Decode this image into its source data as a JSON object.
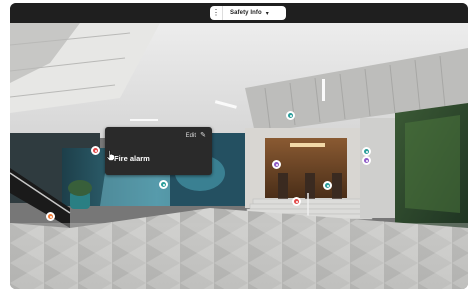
{
  "toolbar": {
    "menu_icon": "vertical-dots-icon",
    "dropdown_label": "Safety Info",
    "dropdown_icon": "chevron-down-icon"
  },
  "tooltip": {
    "edit_label": "Edit",
    "edit_icon": "pencil-icon",
    "tag_title": "Fire alarm"
  },
  "hotspots": [
    {
      "name": "hotspot-fire-alarm",
      "color": "#e24a4a"
    },
    {
      "name": "hotspot-ceiling",
      "color": "#2a9d9a"
    },
    {
      "name": "hotspot-left-wall",
      "color": "#2a9d9a"
    },
    {
      "name": "hotspot-escalator",
      "color": "#f07d3a"
    },
    {
      "name": "hotspot-purple-left",
      "color": "#8e5bc7"
    },
    {
      "name": "hotspot-purple-right",
      "color": "#8e5bc7"
    },
    {
      "name": "hotspot-teal-right",
      "color": "#2a9d9a"
    },
    {
      "name": "hotspot-center",
      "color": "#2a9d9a"
    },
    {
      "name": "hotspot-red-steps",
      "color": "#e24a4a"
    }
  ]
}
